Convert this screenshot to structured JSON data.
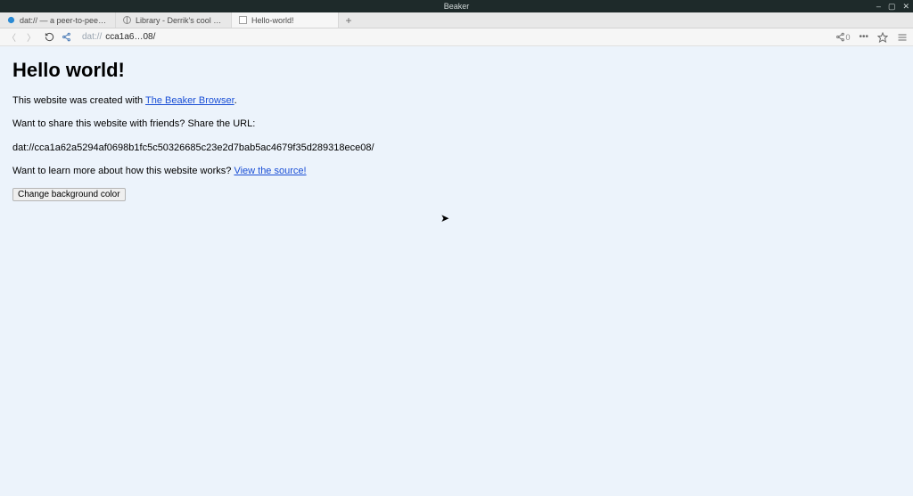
{
  "window": {
    "title": "Beaker",
    "controls": {
      "min": "–",
      "max": "▢",
      "close": "✕"
    }
  },
  "tabs": [
    {
      "label": "dat:// — a peer-to-peer protocol",
      "favicon": "beaker",
      "active": false
    },
    {
      "label": "Library - Derrik's cool website thing",
      "favicon": "globe",
      "active": false
    },
    {
      "label": "Hello-world!",
      "favicon": "doc",
      "active": true
    }
  ],
  "newtab_glyph": "+",
  "toolbar": {
    "back_glyph": "〈",
    "forward_glyph": "〉",
    "url_proto": "dat://",
    "url_path": "cca1a6…08/",
    "share_count": "0",
    "menu_glyph": "•••"
  },
  "page": {
    "heading": "Hello world!",
    "p1_prefix": "This website was created with ",
    "p1_link": "The Beaker Browser",
    "p1_suffix": ".",
    "p2": "Want to share this website with friends? Share the URL:",
    "dat_url": "dat://cca1a62a5294af0698b1fc5c50326685c23e2d7bab5ac4679f35d289318ece08/",
    "p3_prefix": "Want to learn more about how this website works? ",
    "p3_link": "View the source!",
    "button_label": "Change background color"
  }
}
